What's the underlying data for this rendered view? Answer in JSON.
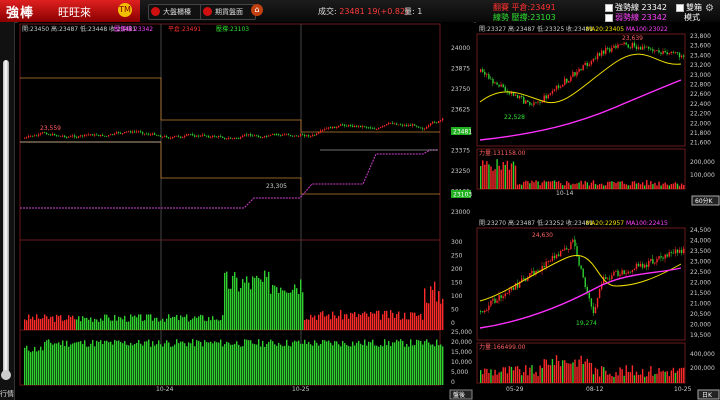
{
  "app": {
    "logo_main": "強棒",
    "logo_sub": "旺旺來",
    "logo_badge": "TM"
  },
  "toolbar": {
    "btn1": "大盤櫃檯",
    "btn2": "期貨盤面",
    "deal_label": "成交:",
    "deal_value": "23481",
    "deal_change": "19(+0.82)",
    "vol_label": "量:",
    "vol_value": "1"
  },
  "top_legend": {
    "a1": "翻賽",
    "a2": "平倉:23491",
    "b1": "線勢",
    "b2": "壓撐:23103",
    "c_label": "強勢線 23342",
    "d_label": "弱勢線 23342",
    "double_label": "雙箱",
    "mode_label": "模式"
  },
  "left_chart": {
    "ohlc": "開:23450 高:23487 低:23448 收:23481",
    "leg1": "壓撐線:23342",
    "leg2": "平倉:23491",
    "leg3": "壓撐:23103",
    "yticks": [
      "24000",
      "23875",
      "23750",
      "23625",
      "23500",
      "23375",
      "23250",
      "23125",
      "23000"
    ],
    "hi_label": "23,559",
    "lo_label": "23,305",
    "price_tag": "23481",
    "sup_tag": "23103",
    "vol_ticks": [
      "300",
      "250",
      "200",
      "150",
      "100",
      "50",
      "0"
    ],
    "obv_ticks": [
      "25,000",
      "20,000",
      "15,000",
      "10,000",
      "5,000",
      "0"
    ],
    "dates": [
      "10-24",
      "10-25"
    ],
    "btn_pan": "盤後"
  },
  "right_top": {
    "ohlc": "開:23327 高:23487 低:23325 收:23481",
    "ma20": "MA20:23405",
    "ma100": "MA100:23022",
    "yticks": [
      "23,800",
      "23,600",
      "23,400",
      "23,200",
      "23,000",
      "22,800",
      "22,600",
      "22,400",
      "22,200",
      "22,000",
      "21,800",
      "21,600"
    ],
    "hi_label": "23,639",
    "lo_label": "22,528",
    "vol_label": "力量:131158.00",
    "vol_ticks": [
      "200,000",
      "100,000"
    ],
    "date": "10-14",
    "btn_tf": "60分K"
  },
  "right_bottom": {
    "ohlc": "開:23270 高:23487 低:23252 收:23481",
    "ma20": "MA20:22957",
    "ma100": "MA100:22415",
    "yticks": [
      "24,500",
      "24,000",
      "23,500",
      "23,000",
      "22,500",
      "22,000",
      "21,500",
      "21,000",
      "20,500",
      "20,000",
      "19,500"
    ],
    "hi_label": "24,630",
    "lo_label": "19,274",
    "vol_label": "力量:166499.00",
    "vol_ticks": [
      "400,000",
      "200,000"
    ],
    "dates": [
      "05-29",
      "08-12",
      "10-25"
    ],
    "btn_tf": "日K"
  },
  "sidebar": {
    "label": "行情"
  },
  "colors": {
    "up": "#ff2a2a",
    "down": "#30d030",
    "ma20": "#f0e000",
    "ma100": "#ff30ff",
    "grid": "#6a1a1a"
  }
}
